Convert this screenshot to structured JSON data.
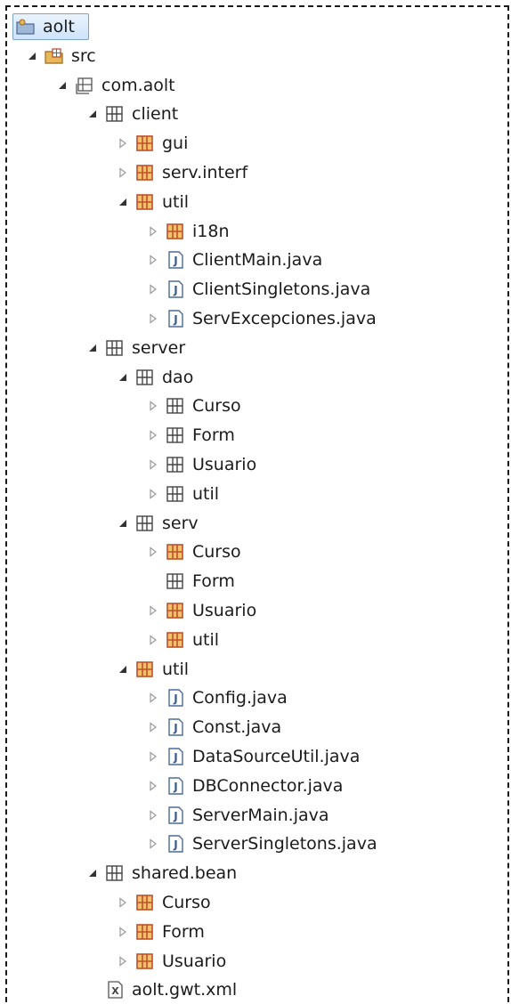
{
  "tree": [
    {
      "label": "aolt",
      "depth": 0,
      "twisty": "none",
      "icon": "project-icon",
      "selected": true
    },
    {
      "label": "src",
      "depth": 1,
      "twisty": "expanded",
      "icon": "source-folder-icon"
    },
    {
      "label": "com.aolt",
      "depth": 2,
      "twisty": "expanded",
      "icon": "package-outline-icon"
    },
    {
      "label": "client",
      "depth": 3,
      "twisty": "expanded",
      "icon": "package-gray-icon"
    },
    {
      "label": "gui",
      "depth": 4,
      "twisty": "collapsed",
      "icon": "package-orange-icon"
    },
    {
      "label": "serv.interf",
      "depth": 4,
      "twisty": "collapsed",
      "icon": "package-orange-icon"
    },
    {
      "label": "util",
      "depth": 4,
      "twisty": "expanded",
      "icon": "package-orange-icon"
    },
    {
      "label": "i18n",
      "depth": 5,
      "twisty": "collapsed",
      "icon": "package-orange-icon"
    },
    {
      "label": "ClientMain.java",
      "depth": 5,
      "twisty": "collapsed",
      "icon": "java-file-icon"
    },
    {
      "label": "ClientSingletons.java",
      "depth": 5,
      "twisty": "collapsed",
      "icon": "java-file-icon"
    },
    {
      "label": "ServExcepciones.java",
      "depth": 5,
      "twisty": "collapsed",
      "icon": "java-file-icon"
    },
    {
      "label": "server",
      "depth": 3,
      "twisty": "expanded",
      "icon": "package-gray-icon"
    },
    {
      "label": "dao",
      "depth": 4,
      "twisty": "expanded",
      "icon": "package-gray-icon"
    },
    {
      "label": "Curso",
      "depth": 5,
      "twisty": "collapsed",
      "icon": "package-gray-icon"
    },
    {
      "label": "Form",
      "depth": 5,
      "twisty": "collapsed",
      "icon": "package-gray-icon"
    },
    {
      "label": "Usuario",
      "depth": 5,
      "twisty": "collapsed",
      "icon": "package-gray-icon"
    },
    {
      "label": "util",
      "depth": 5,
      "twisty": "collapsed",
      "icon": "package-gray-icon"
    },
    {
      "label": "serv",
      "depth": 4,
      "twisty": "expanded",
      "icon": "package-gray-icon"
    },
    {
      "label": "Curso",
      "depth": 5,
      "twisty": "collapsed",
      "icon": "package-orange-icon"
    },
    {
      "label": "Form",
      "depth": 5,
      "twisty": "none",
      "icon": "package-gray-icon"
    },
    {
      "label": "Usuario",
      "depth": 5,
      "twisty": "collapsed",
      "icon": "package-orange-icon"
    },
    {
      "label": "util",
      "depth": 5,
      "twisty": "collapsed",
      "icon": "package-orange-icon"
    },
    {
      "label": "util",
      "depth": 4,
      "twisty": "expanded",
      "icon": "package-orange-icon"
    },
    {
      "label": "Config.java",
      "depth": 5,
      "twisty": "collapsed",
      "icon": "java-file-icon"
    },
    {
      "label": "Const.java",
      "depth": 5,
      "twisty": "collapsed",
      "icon": "java-file-icon"
    },
    {
      "label": "DataSourceUtil.java",
      "depth": 5,
      "twisty": "collapsed",
      "icon": "java-file-icon"
    },
    {
      "label": "DBConnector.java",
      "depth": 5,
      "twisty": "collapsed",
      "icon": "java-file-icon"
    },
    {
      "label": "ServerMain.java",
      "depth": 5,
      "twisty": "collapsed",
      "icon": "java-file-icon"
    },
    {
      "label": "ServerSingletons.java",
      "depth": 5,
      "twisty": "collapsed",
      "icon": "java-file-icon"
    },
    {
      "label": "shared.bean",
      "depth": 3,
      "twisty": "expanded",
      "icon": "package-gray-icon"
    },
    {
      "label": "Curso",
      "depth": 4,
      "twisty": "collapsed",
      "icon": "package-orange-icon"
    },
    {
      "label": "Form",
      "depth": 4,
      "twisty": "collapsed",
      "icon": "package-orange-icon"
    },
    {
      "label": "Usuario",
      "depth": 4,
      "twisty": "collapsed",
      "icon": "package-orange-icon"
    },
    {
      "label": "aolt.gwt.xml",
      "depth": 3,
      "twisty": "none",
      "icon": "xml-file-icon"
    }
  ]
}
